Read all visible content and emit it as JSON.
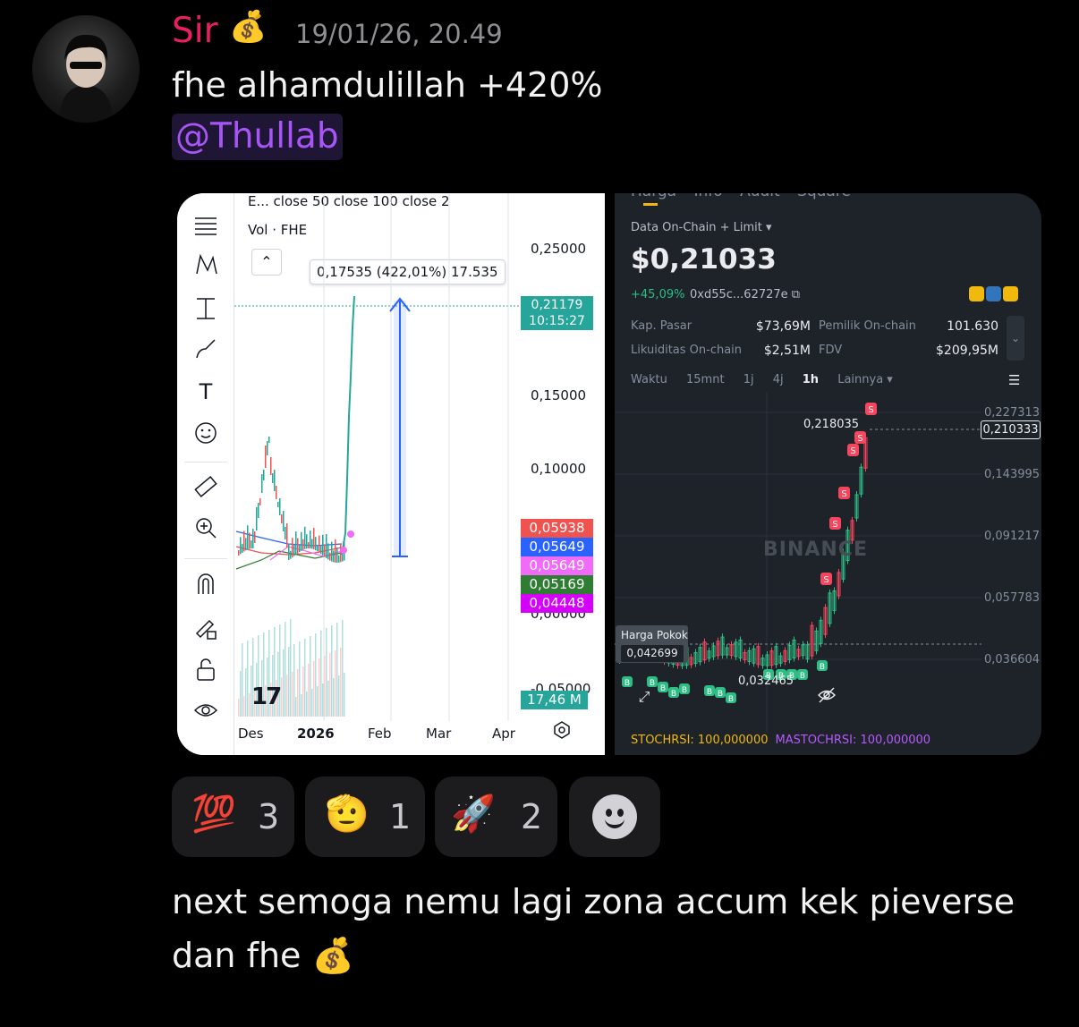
{
  "message": {
    "username": "Sir",
    "username_emoji": "💰",
    "timestamp": "19/01/26, 20.49",
    "text": "fhe alhamdulillah +420%",
    "mention": "@Thullab"
  },
  "chart_left": {
    "legend_line1": "E...  close 50 close 100 close 2",
    "legend_line2": "Vol · FHE",
    "tooltip": "0,17535 (422,01%) 17.535",
    "axis_labels": [
      "0,25000",
      "0,15000",
      "0,10000",
      "0,00000",
      "-0,05000"
    ],
    "price_tag_value": "0,21179",
    "price_tag_time": "10:15:27",
    "ma_tags": [
      {
        "value": "0,05938",
        "color": "#ef5350"
      },
      {
        "value": "0,05649",
        "color": "#2962ff"
      },
      {
        "value": "0,05649",
        "color": "#f06bf7"
      },
      {
        "value": "0,05169",
        "color": "#2e7d32"
      },
      {
        "value": "0,04448",
        "color": "#d500f9"
      }
    ],
    "volume_tag": "17,46 M",
    "x_labels": [
      "Des",
      "2026",
      "Feb",
      "Mar",
      "Apr"
    ],
    "logo": "17",
    "tools": [
      "menu-icon",
      "pattern-icon",
      "measure-line-icon",
      "brush-icon",
      "text-icon",
      "emoji-icon",
      "ruler-icon",
      "zoom-in-icon",
      "magnet-icon",
      "lock-pencil-icon",
      "unlock-icon",
      "eye-icon"
    ],
    "collapse_glyph": "⌃"
  },
  "chart_right": {
    "tabs": "Harga Info Audit Square",
    "source": "Data On-Chain + Limit ▾",
    "price": "$0,21033",
    "change": "+45,09%",
    "address": "0xd55c...62727e",
    "stats": [
      {
        "label": "Kap. Pasar",
        "value": "$73,69M"
      },
      {
        "label": "Pemilik On-chain",
        "value": "101.630"
      },
      {
        "label": "Likuiditas On-chain",
        "value": "$2,51M"
      },
      {
        "label": "FDV",
        "value": "$209,95M"
      }
    ],
    "timeframes": [
      "Waktu",
      "15mnt",
      "1j",
      "4j",
      "1h",
      "Lainnya ▾"
    ],
    "axis_labels": [
      "0,227313",
      "0,143995",
      "0,091217",
      "0,057783",
      "0,036604"
    ],
    "current_tag": "0,210333",
    "high_label": "0,218035",
    "low_label": "0,032465",
    "cost_title": "Harga Pokok",
    "cost_value": "0,042699",
    "watermark": "BINANCE",
    "indicator_a": "STOCHRSI: 100,000000",
    "indicator_b": "MASTOCHRSI: 100,000000"
  },
  "reactions": [
    {
      "emoji": "💯",
      "count": "3"
    },
    {
      "emoji": "🫡",
      "count": "1"
    },
    {
      "emoji": "🚀",
      "count": "2"
    }
  ],
  "followup": {
    "text": "next semoga nemu lagi zona accum kek pieverse dan fhe",
    "emoji": "💰"
  }
}
